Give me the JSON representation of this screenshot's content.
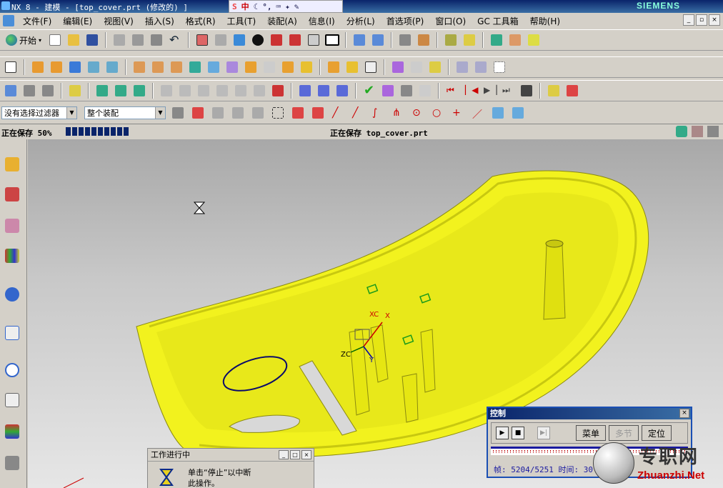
{
  "window": {
    "title": "NX 8 - 建模 - [top_cover.prt (修改的) ]",
    "brand": "SIEMENS",
    "ime_label": "中"
  },
  "menu": {
    "items": [
      "文件(F)",
      "编辑(E)",
      "视图(V)",
      "插入(S)",
      "格式(R)",
      "工具(T)",
      "装配(A)",
      "信息(I)",
      "分析(L)",
      "首选项(P)",
      "窗口(O)",
      "GC 工具箱",
      "帮助(H)"
    ]
  },
  "toolbar": {
    "start_label": "开始"
  },
  "filters": {
    "selection_filter": "没有选择过滤器",
    "scope": "整个装配"
  },
  "status": {
    "left_text": "正在保存 50%",
    "right_text": "正在保存 top_cover.prt",
    "progress_fraction": 0.5
  },
  "viewport": {
    "wcs_labels": {
      "xc": "XC",
      "x": "X",
      "zc": "ZC",
      "y": "Y"
    },
    "model_color": "#f2f21e"
  },
  "work_in_progress": {
    "title": "工作进行中",
    "message_line1": "单击“停止”以中断",
    "message_line2": "此操作。"
  },
  "control": {
    "title": "控制",
    "menu_label": "菜单",
    "section_label": "多节",
    "position_label": "定位",
    "frame_label": "帧:",
    "frame_current": "5204/5251",
    "time_label": "时间:",
    "time_value": "30"
  },
  "watermark": {
    "cn": "专职网",
    "en": "Zhuanzhi.Net"
  }
}
